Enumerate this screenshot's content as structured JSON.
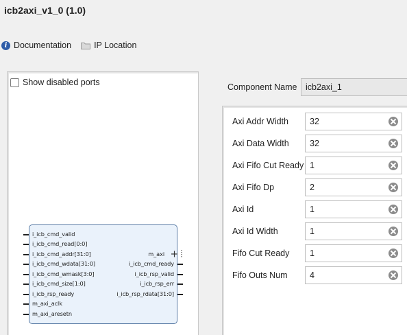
{
  "window": {
    "title": "icb2axi_v1_0 (1.0)"
  },
  "toolbar": {
    "documentation_label": "Documentation",
    "ip_location_label": "IP Location"
  },
  "symbol_panel": {
    "show_disabled_label": "Show disabled ports",
    "show_disabled_checked": false,
    "input_ports": [
      "i_icb_cmd_valid",
      "i_icb_cmd_read[0:0]",
      "i_icb_cmd_addr[31:0]",
      "i_icb_cmd_wdata[31:0]",
      "i_icb_cmd_wmask[3:0]",
      "i_icb_cmd_size[1:0]",
      "i_icb_rsp_ready",
      "m_axi_aclk",
      "m_axi_aresetn"
    ],
    "output_ports": [
      "m_axi",
      "i_icb_cmd_ready",
      "i_icb_rsp_valid",
      "i_icb_rsp_err",
      "i_icb_rsp_rdata[31:0]"
    ]
  },
  "component": {
    "label": "Component Name",
    "value": "icb2axi_1"
  },
  "params": [
    {
      "label": "Axi Addr Width",
      "value": "32"
    },
    {
      "label": "Axi Data Width",
      "value": "32"
    },
    {
      "label": "Axi Fifo Cut Ready",
      "value": "1"
    },
    {
      "label": "Axi Fifo Dp",
      "value": "2"
    },
    {
      "label": "Axi Id",
      "value": "1"
    },
    {
      "label": "Axi Id Width",
      "value": "1"
    },
    {
      "label": "Fifo Cut Ready",
      "value": "1"
    },
    {
      "label": "Fifo Outs Num",
      "value": "4"
    }
  ],
  "colors": {
    "ip_block_fill": "#eaf2fb",
    "ip_block_border": "#5a7ca6",
    "info_icon": "#2f5da8"
  },
  "icons": {
    "documentation": "info-icon",
    "ip_location": "folder-icon",
    "clear": "clear-icon",
    "bus_interface": "plus-icon"
  }
}
